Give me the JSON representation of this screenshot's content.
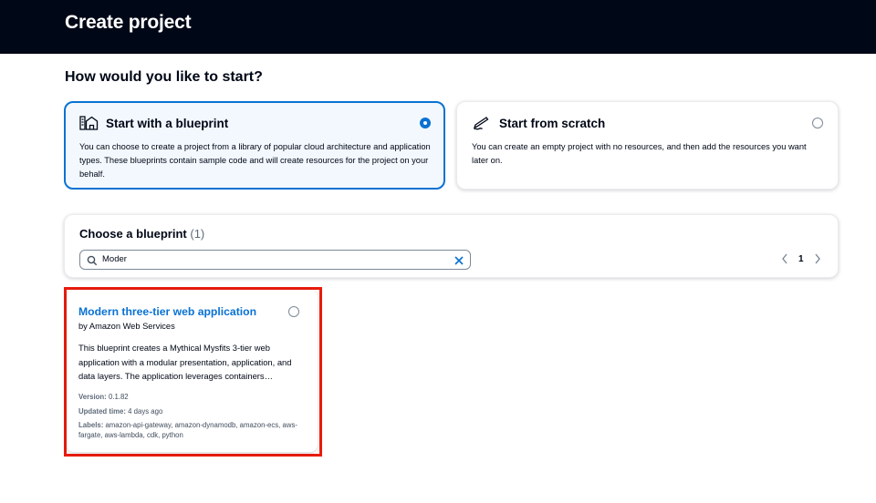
{
  "header": {
    "title": "Create project"
  },
  "start": {
    "heading": "How would you like to start?",
    "options": [
      {
        "title": "Start with a blueprint",
        "description": "You can choose to create a project from a library of popular cloud architecture and application types. These blueprints contain sample code and will create resources for the project on your behalf.",
        "selected": true,
        "icon": "blueprint-icon"
      },
      {
        "title": "Start from scratch",
        "description": "You can create an empty project with no resources, and then add the resources you want later on.",
        "selected": false,
        "icon": "pen-icon"
      }
    ]
  },
  "blueprint_filter": {
    "heading": "Choose a blueprint",
    "count": "(1)",
    "search_value": "Moder",
    "current_page": "1"
  },
  "blueprints": [
    {
      "title": "Modern three-tier web application",
      "author": "by Amazon Web Services",
      "description": "This blueprint creates a Mythical Mysfits 3-tier web application with a modular presentation, application, and data layers. The application leverages containers…",
      "version_label": "Version:",
      "version": "0.1.82",
      "updated_label": "Updated time:",
      "updated": "4 days ago",
      "labels_label": "Labels:",
      "labels": "amazon-api-gateway, amazon-dynamodb, amazon-ecs, aws-fargate, aws-lambda, cdk, python",
      "selected": false
    }
  ],
  "colors": {
    "header_bg": "#000716",
    "accent": "#0972d3",
    "highlight": "#ea1c0c",
    "selected_bg": "#f2f8fd"
  }
}
